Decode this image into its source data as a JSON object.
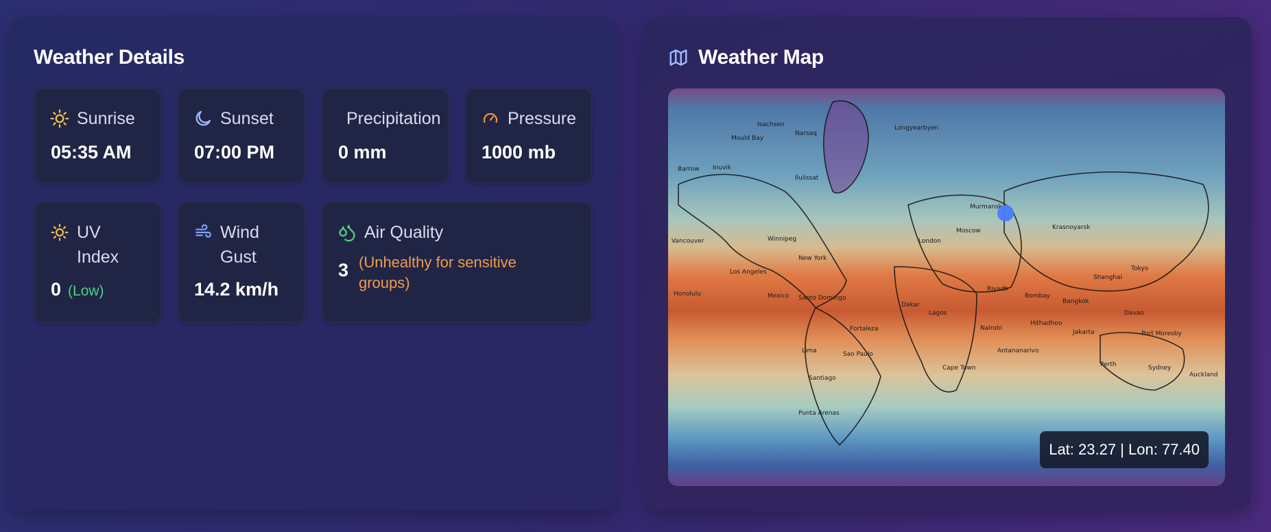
{
  "details": {
    "title": "Weather Details",
    "sunrise": {
      "label": "Sunrise",
      "value": "05:35 AM"
    },
    "sunset": {
      "label": "Sunset",
      "value": "07:00 PM"
    },
    "precipitation": {
      "label": "Precipitation",
      "value": "0 mm"
    },
    "pressure": {
      "label": "Pressure",
      "value": "1000 mb"
    },
    "uv": {
      "label_line1": "UV",
      "label_line2": "Index",
      "value": "0",
      "level": "(Low)"
    },
    "wind_gust": {
      "label_line1": "Wind",
      "label_line2": "Gust",
      "value": "14.2 km/h"
    },
    "air_quality": {
      "label": "Air Quality",
      "value": "3",
      "description": "(Unhealthy for sensitive groups)"
    }
  },
  "map": {
    "title": "Weather Map",
    "coordinates": "Lat: 23.27 | Lon: 77.40",
    "place_labels": [
      "Barrow",
      "Inuvik",
      "Mould Bay",
      "Isachsen",
      "Narsaq",
      "Longyearbyen",
      "Ilulissat",
      "Vancouver",
      "Winnipeg",
      "New York",
      "Los Angeles",
      "Mexico",
      "Honolulu",
      "Santo Domingo",
      "Lima",
      "Santiago",
      "Sao Paulo",
      "Fortaleza",
      "Punta Arenas",
      "London",
      "Moscow",
      "Murmansk",
      "Krasnoyarsk",
      "Dakar",
      "Lagos",
      "Nairobi",
      "Riyadh",
      "Bombay",
      "Bangkok",
      "Shanghai",
      "Tokyo",
      "Jakarta",
      "Davao",
      "Port Moresby",
      "Perth",
      "Sydney",
      "Auckland",
      "Cape Town",
      "Antananarivo",
      "Hithadhoo"
    ]
  },
  "colors": {
    "sun_icon": "#f6c24a",
    "moon_icon": "#9fb6ff",
    "pressure_icon": "#f2994a",
    "wind_icon": "#7ea6ff",
    "air_icon": "#4fd27a",
    "uv_level": "#4fd27a",
    "air_desc": "#f29a4d",
    "marker": "#4a7cff"
  }
}
